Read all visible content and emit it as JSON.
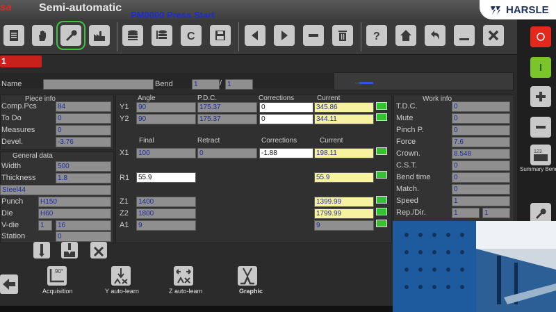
{
  "app": {
    "logo_text": "sa",
    "title": "Semi-automatic",
    "status_message": "PM0000 Press Start",
    "brand": "HARSLE"
  },
  "toolbar": {
    "icons": [
      "document-icon",
      "hand-icon",
      "wrench-icon",
      "factory-icon",
      "database-list-icon",
      "database-edit-icon",
      "clear-icon",
      "save-icon",
      "arrow-left-icon",
      "arrow-right-icon",
      "minus-icon",
      "trash-icon",
      "help-icon",
      "home-icon",
      "undo-icon",
      "minimize-icon",
      "close-icon"
    ]
  },
  "right_strip": {
    "summary_label": "Summary Bend",
    "summary_counter": "123"
  },
  "page_tab": "1",
  "header_row": {
    "name_label": "Name",
    "name_value": "",
    "bend_label": "Bend",
    "bend_value": "1",
    "bend_sep": "/",
    "bend_total": "1"
  },
  "piece_info": {
    "title": "Piece info",
    "rows": [
      {
        "label": "Comp.Pcs",
        "value": "84"
      },
      {
        "label": "To Do",
        "value": "0"
      },
      {
        "label": "Measures",
        "value": "0"
      },
      {
        "label": "Devel.",
        "value": "-3.76"
      }
    ]
  },
  "general_data": {
    "title": "General data",
    "width_label": "Width",
    "width": "500",
    "thickness_label": "Thickness",
    "thickness": "1.8",
    "material": "Steel44",
    "punch_label": "Punch",
    "punch": "H150",
    "die_label": "Die",
    "die": "H60",
    "vdie_label": "V-die",
    "vdie_a": "1",
    "vdie_b": "16",
    "station_label": "Station",
    "station": "0"
  },
  "axes": {
    "col_angle": "Angle",
    "col_pdc": "P.D.C.",
    "col_corrections": "Corrections",
    "col_current": "Current",
    "y1": {
      "label": "Y1",
      "angle": "90",
      "pdc": "175.37",
      "corr": "0",
      "current": "345.86"
    },
    "y2": {
      "label": "Y2",
      "angle": "90",
      "pdc": "175.37",
      "corr": "0",
      "current": "344.11"
    },
    "col_final": "Final",
    "col_retract": "Retract",
    "col_corrections2": "Corrections",
    "col_current2": "Current",
    "x1": {
      "label": "X1",
      "final": "100",
      "retract": "0",
      "corr": "-1.88",
      "current": "198.11"
    },
    "r1": {
      "label": "R1",
      "final": "55.9",
      "current": "55.9"
    },
    "z1": {
      "label": "Z1",
      "final": "1400",
      "current": "1399.99"
    },
    "z2": {
      "label": "Z2",
      "final": "1800",
      "current": "1799.99"
    },
    "a1": {
      "label": "A1",
      "final": "9",
      "current": "9"
    }
  },
  "work_info": {
    "title": "Work info",
    "rows": [
      {
        "label": "T.D.C.",
        "value": "0"
      },
      {
        "label": "Mute",
        "value": "0"
      },
      {
        "label": "Pinch P.",
        "value": "0"
      },
      {
        "label": "Force",
        "value": "7.6"
      },
      {
        "label": "Crown.",
        "value": "8.548"
      },
      {
        "label": "C.S.T.",
        "value": "0"
      },
      {
        "label": "Bend time",
        "value": "0"
      },
      {
        "label": "Match.",
        "value": "0"
      },
      {
        "label": "Speed",
        "value": "1"
      }
    ],
    "rep_label": "Rep./Dir.",
    "rep_a": "1",
    "rep_b": "1"
  },
  "bottom": {
    "acq": "Acquisition",
    "acq_icon_text": "90°",
    "y_auto": "Y auto-learn",
    "z_auto": "Z auto-learn",
    "graphic": "Graphic"
  },
  "colors": {
    "accent_red": "#c8201a",
    "led_green": "#33c233",
    "value_blue": "#1e2e9a"
  }
}
